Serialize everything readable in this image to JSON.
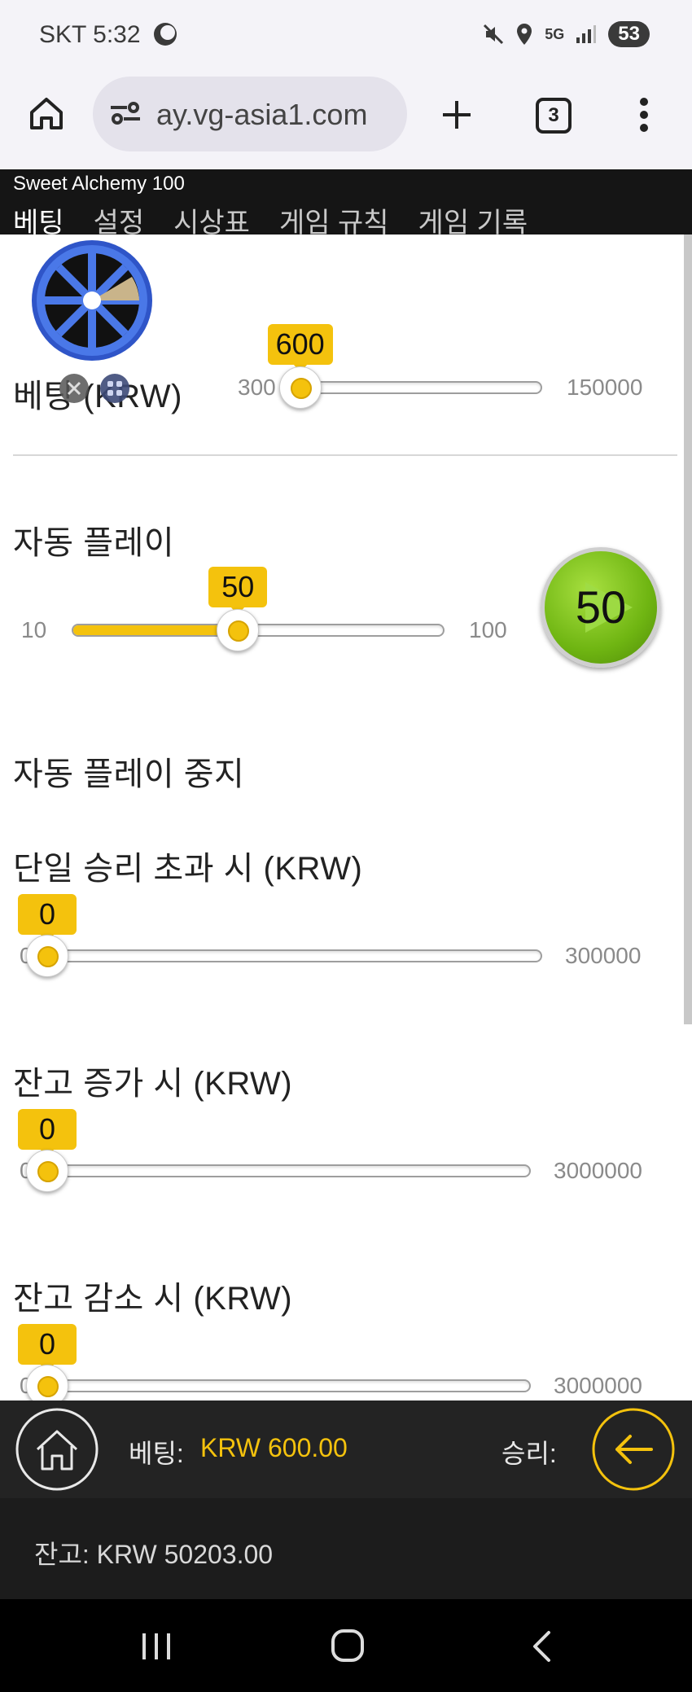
{
  "status": {
    "carrier_time": "SKT 5:32",
    "network": "5G",
    "battery": "53"
  },
  "browser": {
    "url": "ay.vg-asia1.com",
    "tab_count": "3"
  },
  "game": {
    "title": "Sweet Alchemy 100",
    "tabs": [
      "베팅",
      "설정",
      "시상표",
      "게임 규칙",
      "게임 기록"
    ],
    "active_tab": "베팅"
  },
  "bet": {
    "label": "베팅 (KRW)",
    "value": "600",
    "min": "300",
    "max": "150000",
    "fraction": 0.002
  },
  "autoplay": {
    "label": "자동 플레이",
    "value": "50",
    "min": "10",
    "max": "100",
    "fraction": 0.444,
    "start_label": "50"
  },
  "stop_autoplay": {
    "heading": "자동 플레이 중지",
    "single_win": {
      "label": "단일 승리 초과 시 (KRW)",
      "value": "0",
      "min": "0",
      "max": "300000",
      "fraction": 0
    },
    "balance_increase": {
      "label": "잔고 증가 시 (KRW)",
      "value": "0",
      "min": "0",
      "max": "3000000",
      "fraction": 0
    },
    "balance_decrease": {
      "label": "잔고 감소 시 (KRW)",
      "value": "0",
      "min": "0",
      "max": "3000000",
      "fraction": 0
    }
  },
  "bottom": {
    "bet_label": "베팅:",
    "bet_value": "KRW 600.00",
    "win_label": "승리:",
    "balance": "잔고: KRW 50203.00"
  },
  "colors": {
    "accent": "#f4c20d",
    "play_green": "#7cc21a",
    "header_bg": "#151515"
  }
}
